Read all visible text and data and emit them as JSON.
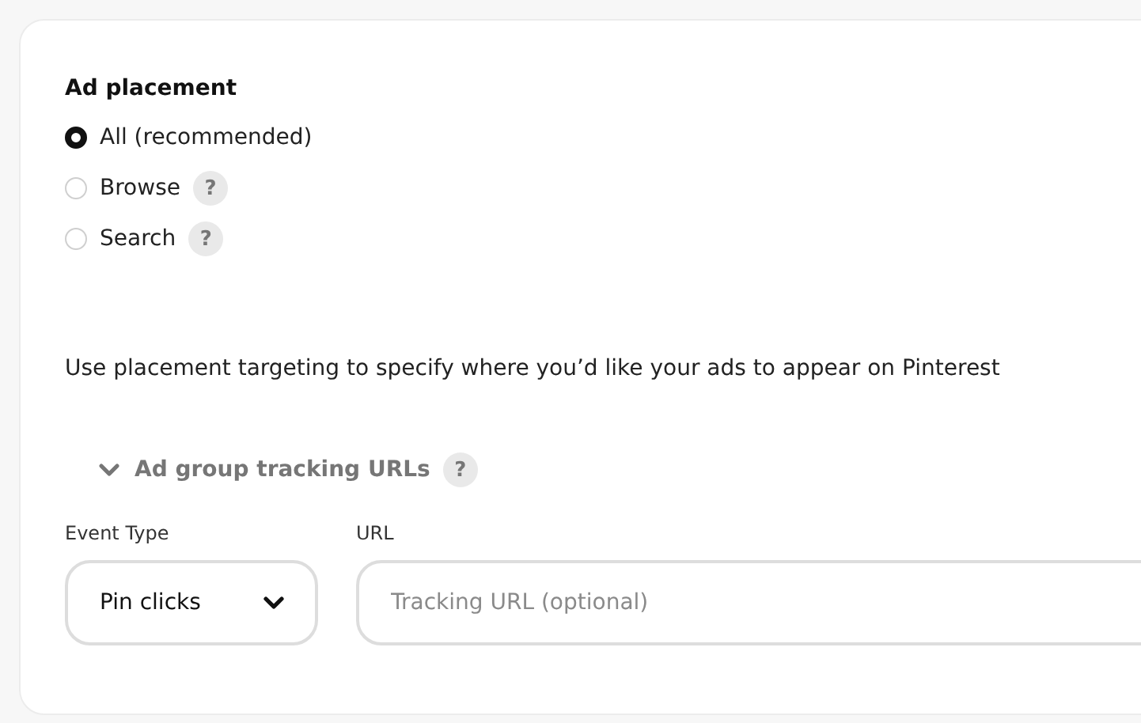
{
  "section": {
    "title": "Ad placement",
    "options": [
      {
        "label": "All (recommended)",
        "selected": true
      },
      {
        "label": "Browse",
        "selected": false,
        "help": "?"
      },
      {
        "label": "Search",
        "selected": false,
        "help": "?"
      }
    ],
    "description": "Use placement targeting to specify where you’d like your ads to appear on Pinterest"
  },
  "tracking": {
    "title": "Ad group tracking URLs",
    "expanded": true,
    "help": "?",
    "event_type": {
      "label": "Event Type",
      "value": "Pin clicks"
    },
    "url": {
      "label": "URL",
      "placeholder": "Tracking URL (optional)"
    }
  }
}
